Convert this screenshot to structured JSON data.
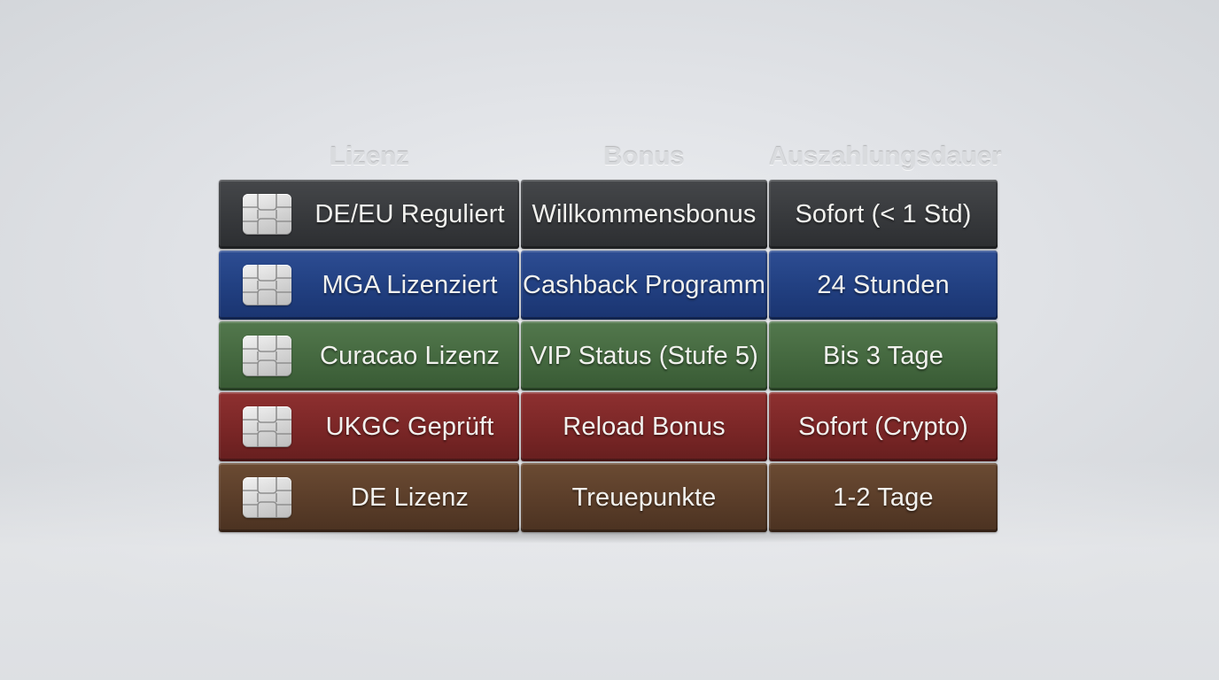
{
  "headers": {
    "lizenz": "Lizenz",
    "bonus": "Bonus",
    "dauer": "Auszahlungsdauer"
  },
  "rows": [
    {
      "color": "#37393c",
      "lizenz": "DE/EU Reguliert",
      "bonus": "Willkommensbonus",
      "dauer": "Sofort (< 1 Std)"
    },
    {
      "color": "#213f80",
      "lizenz": "MGA Lizenziert",
      "bonus": "Cashback Programm",
      "dauer": "24 Stunden"
    },
    {
      "color": "#44683f",
      "lizenz": "Curacao Lizenz",
      "bonus": "VIP Status (Stufe 5)",
      "dauer": "Bis 3 Tage"
    },
    {
      "color": "#7a2626",
      "lizenz": "UKGC Geprüft",
      "bonus": "Reload Bonus",
      "dauer": "Sofort (Crypto)"
    },
    {
      "color": "#5a3d29",
      "lizenz": "DE Lizenz",
      "bonus": "Treuepunkte",
      "dauer": "1-2 Tage"
    }
  ],
  "icons": {
    "row_icon": "chip-icon"
  }
}
